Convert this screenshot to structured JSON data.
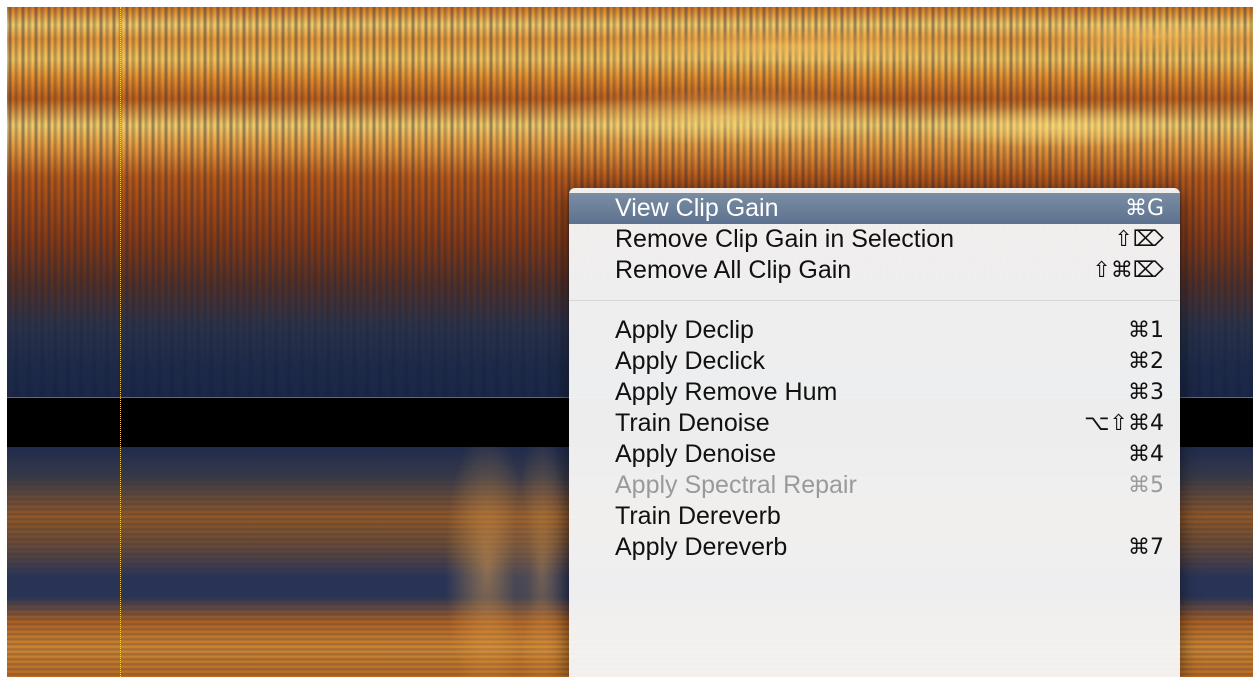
{
  "menu": {
    "items": [
      {
        "label": "View Clip Gain",
        "shortcut": "⌘G",
        "state": "selected"
      },
      {
        "label": "Remove Clip Gain in Selection",
        "shortcut": "⇧⌦",
        "state": "enabled"
      },
      {
        "label": "Remove All Clip Gain",
        "shortcut": "⇧⌘⌦",
        "state": "enabled"
      },
      {
        "label": "Apply Declip",
        "shortcut": "⌘1",
        "state": "enabled"
      },
      {
        "label": "Apply Declick",
        "shortcut": "⌘2",
        "state": "enabled"
      },
      {
        "label": "Apply Remove Hum",
        "shortcut": "⌘3",
        "state": "enabled"
      },
      {
        "label": "Train Denoise",
        "shortcut": "⌥⇧⌘4",
        "state": "enabled"
      },
      {
        "label": "Apply Denoise",
        "shortcut": "⌘4",
        "state": "enabled"
      },
      {
        "label": "Apply Spectral Repair",
        "shortcut": "⌘5",
        "state": "disabled"
      },
      {
        "label": "Train Dereverb",
        "shortcut": "",
        "state": "enabled"
      },
      {
        "label": "Apply Dereverb",
        "shortcut": "⌘7",
        "state": "enabled"
      }
    ]
  },
  "colors": {
    "selection": "#6a7f9a",
    "playhead": "#ffd24a",
    "spectrogram_hot": "#ffd46a",
    "spectrogram_cold": "#1c2a48"
  }
}
